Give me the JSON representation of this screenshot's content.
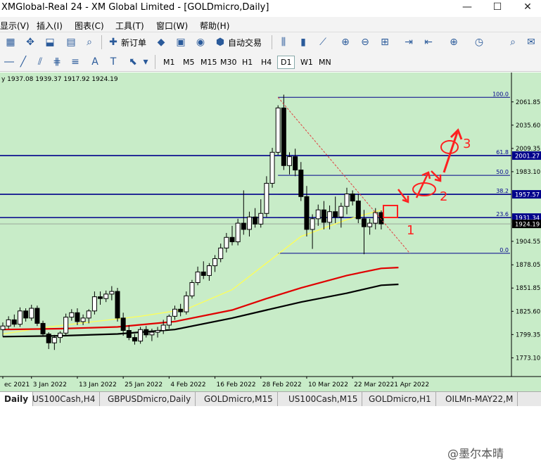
{
  "window": {
    "title": "XMGlobal-Real 24 - XM Global Limited - [GOLDmicro,Daily]",
    "minimize": "—",
    "maximize": "☐",
    "close": "✕"
  },
  "menu": [
    "显示(V)",
    "插入(I)",
    "图表(C)",
    "工具(T)",
    "窗口(W)",
    "帮助(H)"
  ],
  "toolbar": {
    "new_order": "新订单",
    "auto_trading": "自动交易"
  },
  "timeframes": [
    "M1",
    "M5",
    "M15",
    "M30",
    "H1",
    "H4",
    "D1",
    "W1",
    "MN"
  ],
  "active_timeframe": "D1",
  "chart_header": "y 1937.08 1939.37 1917.92 1924.19",
  "chart_data": {
    "type": "candlestick",
    "symbol": "GOLDmicro",
    "timeframe": "Daily",
    "ohlc_last": {
      "open": 1937.08,
      "high": 1939.37,
      "low": 1917.92,
      "close": 1924.19
    },
    "price_ticks": [
      2061.85,
      2035.6,
      2009.35,
      1983.1,
      1957.57,
      1931.34,
      1904.55,
      1878.05,
      1851.85,
      1825.6,
      1799.35,
      1773.1
    ],
    "price_tick_labels": [
      "2061.85",
      "2035.60",
      "2009.35",
      "1983.10",
      "1957.57",
      "1931.34",
      "1904.55",
      "1878.05",
      "1851.85",
      "1825.60",
      "1799.35",
      "1773.10"
    ],
    "y_range": [
      1752,
      2095
    ],
    "date_labels": [
      "ec 2021",
      "3 Jan 2022",
      "13 Jan 2022",
      "25 Jan 2022",
      "4 Feb 2022",
      "16 Feb 2022",
      "28 Feb 2022",
      "10 Mar 2022",
      "22 Mar 2022",
      "1 Apr 2022"
    ],
    "date_label_index": [
      0,
      5,
      13,
      21,
      29,
      37,
      45,
      53,
      61,
      68
    ],
    "num_bars": 74,
    "candles": [
      [
        1805,
        1813,
        1797,
        1809
      ],
      [
        1809,
        1820,
        1806,
        1816
      ],
      [
        1816,
        1822,
        1808,
        1811
      ],
      [
        1811,
        1830,
        1808,
        1826
      ],
      [
        1826,
        1829,
        1814,
        1818
      ],
      [
        1818,
        1833,
        1815,
        1829
      ],
      [
        1829,
        1832,
        1809,
        1812
      ],
      [
        1812,
        1815,
        1798,
        1800
      ],
      [
        1800,
        1802,
        1783,
        1790
      ],
      [
        1790,
        1799,
        1782,
        1796
      ],
      [
        1796,
        1803,
        1790,
        1801
      ],
      [
        1801,
        1823,
        1798,
        1819
      ],
      [
        1819,
        1828,
        1815,
        1824
      ],
      [
        1824,
        1829,
        1810,
        1814
      ],
      [
        1814,
        1822,
        1810,
        1818
      ],
      [
        1818,
        1828,
        1812,
        1826
      ],
      [
        1826,
        1848,
        1822,
        1842
      ],
      [
        1842,
        1848,
        1833,
        1840
      ],
      [
        1840,
        1849,
        1836,
        1845
      ],
      [
        1845,
        1854,
        1838,
        1848
      ],
      [
        1848,
        1852,
        1814,
        1818
      ],
      [
        1818,
        1824,
        1798,
        1804
      ],
      [
        1804,
        1810,
        1793,
        1796
      ],
      [
        1796,
        1800,
        1788,
        1792
      ],
      [
        1792,
        1808,
        1789,
        1805
      ],
      [
        1805,
        1809,
        1796,
        1799
      ],
      [
        1799,
        1806,
        1792,
        1802
      ],
      [
        1802,
        1808,
        1796,
        1804
      ],
      [
        1804,
        1816,
        1800,
        1810
      ],
      [
        1810,
        1822,
        1806,
        1820
      ],
      [
        1820,
        1832,
        1816,
        1828
      ],
      [
        1828,
        1834,
        1820,
        1825
      ],
      [
        1825,
        1848,
        1822,
        1843
      ],
      [
        1843,
        1861,
        1840,
        1858
      ],
      [
        1858,
        1876,
        1855,
        1870
      ],
      [
        1870,
        1882,
        1862,
        1866
      ],
      [
        1866,
        1880,
        1860,
        1877
      ],
      [
        1877,
        1889,
        1870,
        1885
      ],
      [
        1885,
        1902,
        1881,
        1897
      ],
      [
        1897,
        1914,
        1892,
        1909
      ],
      [
        1909,
        1922,
        1900,
        1904
      ],
      [
        1904,
        1930,
        1900,
        1925
      ],
      [
        1925,
        1962,
        1912,
        1918
      ],
      [
        1918,
        1938,
        1910,
        1932
      ],
      [
        1932,
        1942,
        1920,
        1924
      ],
      [
        1924,
        1952,
        1920,
        1936
      ],
      [
        1936,
        1978,
        1932,
        1970
      ],
      [
        1970,
        2010,
        1965,
        2005
      ],
      [
        2005,
        2058,
        2002,
        2055
      ],
      [
        2055,
        2070,
        1985,
        1990
      ],
      [
        1990,
        2005,
        1980,
        2000
      ],
      [
        2000,
        2009,
        1978,
        1985
      ],
      [
        1985,
        1994,
        1950,
        1955
      ],
      [
        1955,
        1967,
        1910,
        1918
      ],
      [
        1918,
        1935,
        1896,
        1930
      ],
      [
        1930,
        1946,
        1922,
        1940
      ],
      [
        1940,
        1950,
        1918,
        1926
      ],
      [
        1926,
        1945,
        1918,
        1938
      ],
      [
        1938,
        1955,
        1925,
        1932
      ],
      [
        1932,
        1948,
        1920,
        1944
      ],
      [
        1944,
        1965,
        1935,
        1958
      ],
      [
        1958,
        1962,
        1945,
        1950
      ],
      [
        1950,
        1958,
        1925,
        1930
      ],
      [
        1930,
        1940,
        1890,
        1921
      ],
      [
        1921,
        1930,
        1912,
        1925
      ],
      [
        1925,
        1942,
        1918,
        1937
      ],
      [
        1937,
        1939.37,
        1917.92,
        1924.19
      ]
    ],
    "moving_averages": [
      {
        "name": "yellow",
        "color": "#ffff55",
        "points": [
          [
            0,
            1800
          ],
          [
            8,
            1808
          ],
          [
            16,
            1814
          ],
          [
            24,
            1820
          ],
          [
            32,
            1828
          ],
          [
            40,
            1850
          ],
          [
            46,
            1880
          ],
          [
            52,
            1910
          ],
          [
            60,
            1929
          ],
          [
            66,
            1940
          ]
        ]
      },
      {
        "name": "red",
        "color": "#e00000",
        "points": [
          [
            0,
            1805
          ],
          [
            10,
            1806
          ],
          [
            20,
            1808
          ],
          [
            30,
            1814
          ],
          [
            40,
            1827
          ],
          [
            46,
            1840
          ],
          [
            52,
            1852
          ],
          [
            60,
            1866
          ],
          [
            66,
            1874
          ],
          [
            69,
            1875
          ]
        ]
      },
      {
        "name": "black",
        "color": "#000000",
        "points": [
          [
            0,
            1797
          ],
          [
            10,
            1798
          ],
          [
            20,
            1800
          ],
          [
            30,
            1805
          ],
          [
            40,
            1818
          ],
          [
            46,
            1827
          ],
          [
            52,
            1836
          ],
          [
            60,
            1846
          ],
          [
            66,
            1855
          ],
          [
            69,
            1856
          ]
        ]
      }
    ],
    "horizontal_lines": [
      {
        "price": 2001.27,
        "label": "2001.27",
        "color": "#00008b",
        "tag_bg": "#00008b"
      },
      {
        "price": 1957.57,
        "label": "1957.57",
        "color": "#00008b",
        "tag_bg": "#00008b"
      },
      {
        "price": 1931.34,
        "label": "1931.34",
        "color": "#00008b",
        "tag_bg": "#00008b"
      }
    ],
    "current_price": {
      "price": 1924.19,
      "label": "1924.19"
    },
    "fibonacci": {
      "x_start": 48,
      "x_end": 74,
      "high": 2067,
      "low": 1891,
      "levels": [
        {
          "ratio": "100.0",
          "price": 2067
        },
        {
          "ratio": "61.8",
          "price": 2001.27
        },
        {
          "ratio": "50.0",
          "price": 1979
        },
        {
          "ratio": "38.2",
          "price": 1957.57
        },
        {
          "ratio": "23.6",
          "price": 1931.34
        },
        {
          "ratio": "0.0",
          "price": 1891
        }
      ]
    },
    "trendline": {
      "color": "#e04040",
      "from": [
        48,
        2067
      ],
      "to": [
        71,
        1891
      ]
    },
    "annotations": {
      "label_1": "1",
      "label_2": "2",
      "label_3": "3"
    }
  },
  "tabs": [
    "Daily",
    "US100Cash,H4",
    "GBPUSDmicro,Daily",
    "GOLDmicro,M15",
    "US100Cash,M15",
    "GOLDmicro,H1",
    "OILMn-MAY22,M"
  ],
  "watermark": "@墨尔本晴"
}
